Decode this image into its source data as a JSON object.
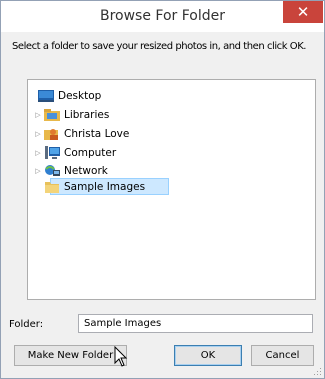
{
  "window": {
    "title": "Browse For Folder",
    "close_label": "✕"
  },
  "instruction": "Select a folder to save your resized photos in, and then click OK.",
  "tree": {
    "items": [
      {
        "label": "Desktop",
        "icon": "desktop-icon",
        "expandable": false
      },
      {
        "label": "Libraries",
        "icon": "libraries-icon",
        "expandable": true
      },
      {
        "label": "Christa Love",
        "icon": "user-folder-icon",
        "expandable": true
      },
      {
        "label": "Computer",
        "icon": "computer-icon",
        "expandable": true
      },
      {
        "label": "Network",
        "icon": "network-icon",
        "expandable": true
      },
      {
        "label": "Sample Images",
        "icon": "folder-icon",
        "expandable": false,
        "selected": true
      }
    ],
    "expand_glyph": "▷"
  },
  "folder": {
    "label": "Folder:",
    "value": "Sample Images"
  },
  "buttons": {
    "make_new_folder": "Make New Folder",
    "ok": "OK",
    "cancel": "Cancel"
  },
  "colors": {
    "close": "#c9443b",
    "selection_fill": "#cde8ff",
    "selection_border": "#99d1ff",
    "dialog_bg": "#f0f0f0"
  }
}
